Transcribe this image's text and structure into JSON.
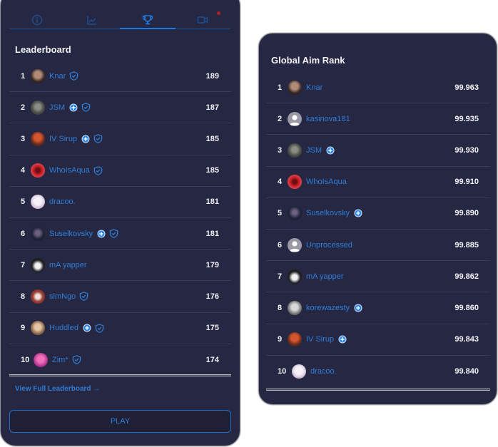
{
  "leaderboard_card": {
    "tabs": [
      {
        "icon": "info-icon",
        "active": false
      },
      {
        "icon": "chart-icon",
        "active": false
      },
      {
        "icon": "trophy-icon",
        "active": true
      },
      {
        "icon": "video-icon",
        "active": false,
        "notification": true
      }
    ],
    "title": "Leaderboard",
    "rows": [
      {
        "rank": "1",
        "name": "Knar",
        "avatar": "knar",
        "plus": false,
        "verified": true,
        "score": "189"
      },
      {
        "rank": "2",
        "name": "JSM",
        "avatar": "jsm",
        "plus": true,
        "verified": true,
        "score": "187"
      },
      {
        "rank": "3",
        "name": "IV Sirup",
        "avatar": "sirup",
        "plus": true,
        "verified": true,
        "score": "185"
      },
      {
        "rank": "4",
        "name": "WhoIsAqua",
        "avatar": "aqua",
        "plus": false,
        "verified": true,
        "score": "185"
      },
      {
        "rank": "5",
        "name": "dracoo.",
        "avatar": "dracoo",
        "plus": false,
        "verified": false,
        "score": "181"
      },
      {
        "rank": "6",
        "name": "Suselkovsky",
        "avatar": "susel",
        "plus": true,
        "verified": true,
        "score": "181"
      },
      {
        "rank": "7",
        "name": "mA yapper",
        "avatar": "yapper",
        "plus": false,
        "verified": false,
        "score": "179"
      },
      {
        "rank": "8",
        "name": "slmNgo",
        "avatar": "slmngo",
        "plus": false,
        "verified": true,
        "score": "176"
      },
      {
        "rank": "9",
        "name": "Huddled",
        "avatar": "huddled",
        "plus": true,
        "verified": true,
        "score": "175"
      },
      {
        "rank": "10",
        "name": "Zim*",
        "avatar": "zim",
        "plus": false,
        "verified": true,
        "score": "174"
      }
    ],
    "view_full_label": "View Full Leaderboard →",
    "play_label": "PLAY"
  },
  "global_aim_rank_card": {
    "title": "Global Aim Rank",
    "rows": [
      {
        "rank": "1",
        "name": "Knar",
        "avatar": "knar",
        "plus": false,
        "score": "99.963"
      },
      {
        "rank": "2",
        "name": "kasinova181",
        "avatar": "default",
        "plus": false,
        "score": "99.935"
      },
      {
        "rank": "3",
        "name": "JSM",
        "avatar": "jsm",
        "plus": true,
        "score": "99.930"
      },
      {
        "rank": "4",
        "name": "WhoIsAqua",
        "avatar": "aqua",
        "plus": false,
        "score": "99.910"
      },
      {
        "rank": "5",
        "name": "Suselkovsky",
        "avatar": "susel",
        "plus": true,
        "score": "99.890"
      },
      {
        "rank": "6",
        "name": "Unprocessed",
        "avatar": "default",
        "plus": false,
        "score": "99.885"
      },
      {
        "rank": "7",
        "name": "mA yapper",
        "avatar": "yapper",
        "plus": false,
        "score": "99.862"
      },
      {
        "rank": "8",
        "name": "korewazesty",
        "avatar": "kore",
        "plus": true,
        "score": "99.860"
      },
      {
        "rank": "9",
        "name": "IV Sirup",
        "avatar": "sirup",
        "plus": true,
        "score": "99.843"
      },
      {
        "rank": "10",
        "name": "dracoo.",
        "avatar": "dracoo",
        "plus": false,
        "score": "99.840"
      }
    ]
  },
  "colors": {
    "card_bg": "#262742",
    "accent_blue": "#2f7dd6",
    "active_tab_blue": "#1f7be0",
    "notification_red": "#b11f2b"
  }
}
